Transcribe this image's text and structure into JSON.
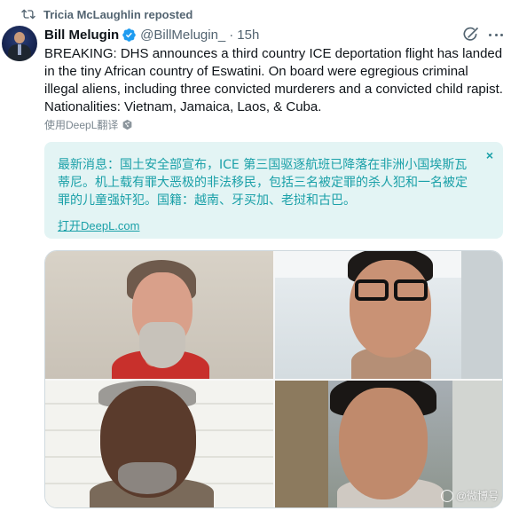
{
  "repost": {
    "icon": "repost-icon",
    "text": "Tricia McLaughlin reposted"
  },
  "author": {
    "display_name": "Bill Melugin",
    "verified": true,
    "handle": "@BillMelugin_",
    "separator": "·",
    "time": "15h"
  },
  "tweet": {
    "text": "BREAKING: DHS announces a third country ICE deportation flight has landed in the tiny African country of Eswatini. On board were egregious criminal illegal aliens, including three convicted murderers and a convicted child rapist. Nationalities: Vietnam, Jamaica, Laos, & Cuba."
  },
  "translate": {
    "label": "使用DeepL翻译"
  },
  "deepl": {
    "translation": "最新消息：国土安全部宣布，ICE 第三国驱逐航班已降落在非洲小国埃斯瓦蒂尼。机上载有罪大恶极的非法移民，包括三名被定罪的杀人犯和一名被定罪的儿童强奸犯。国籍：越南、牙买加、老挝和古巴。",
    "close": "×",
    "open_link": "打开DeepL.com",
    "color": "#1aa0a8"
  },
  "media": {
    "photos": [
      "mugshot-1",
      "mugshot-2",
      "mugshot-3",
      "mugshot-4"
    ],
    "watermark": "@微博号"
  },
  "colors": {
    "text": "#0f1419",
    "secondary": "#536471",
    "verified": "#1d9bf0",
    "card_bg": "#e3f4f4"
  }
}
